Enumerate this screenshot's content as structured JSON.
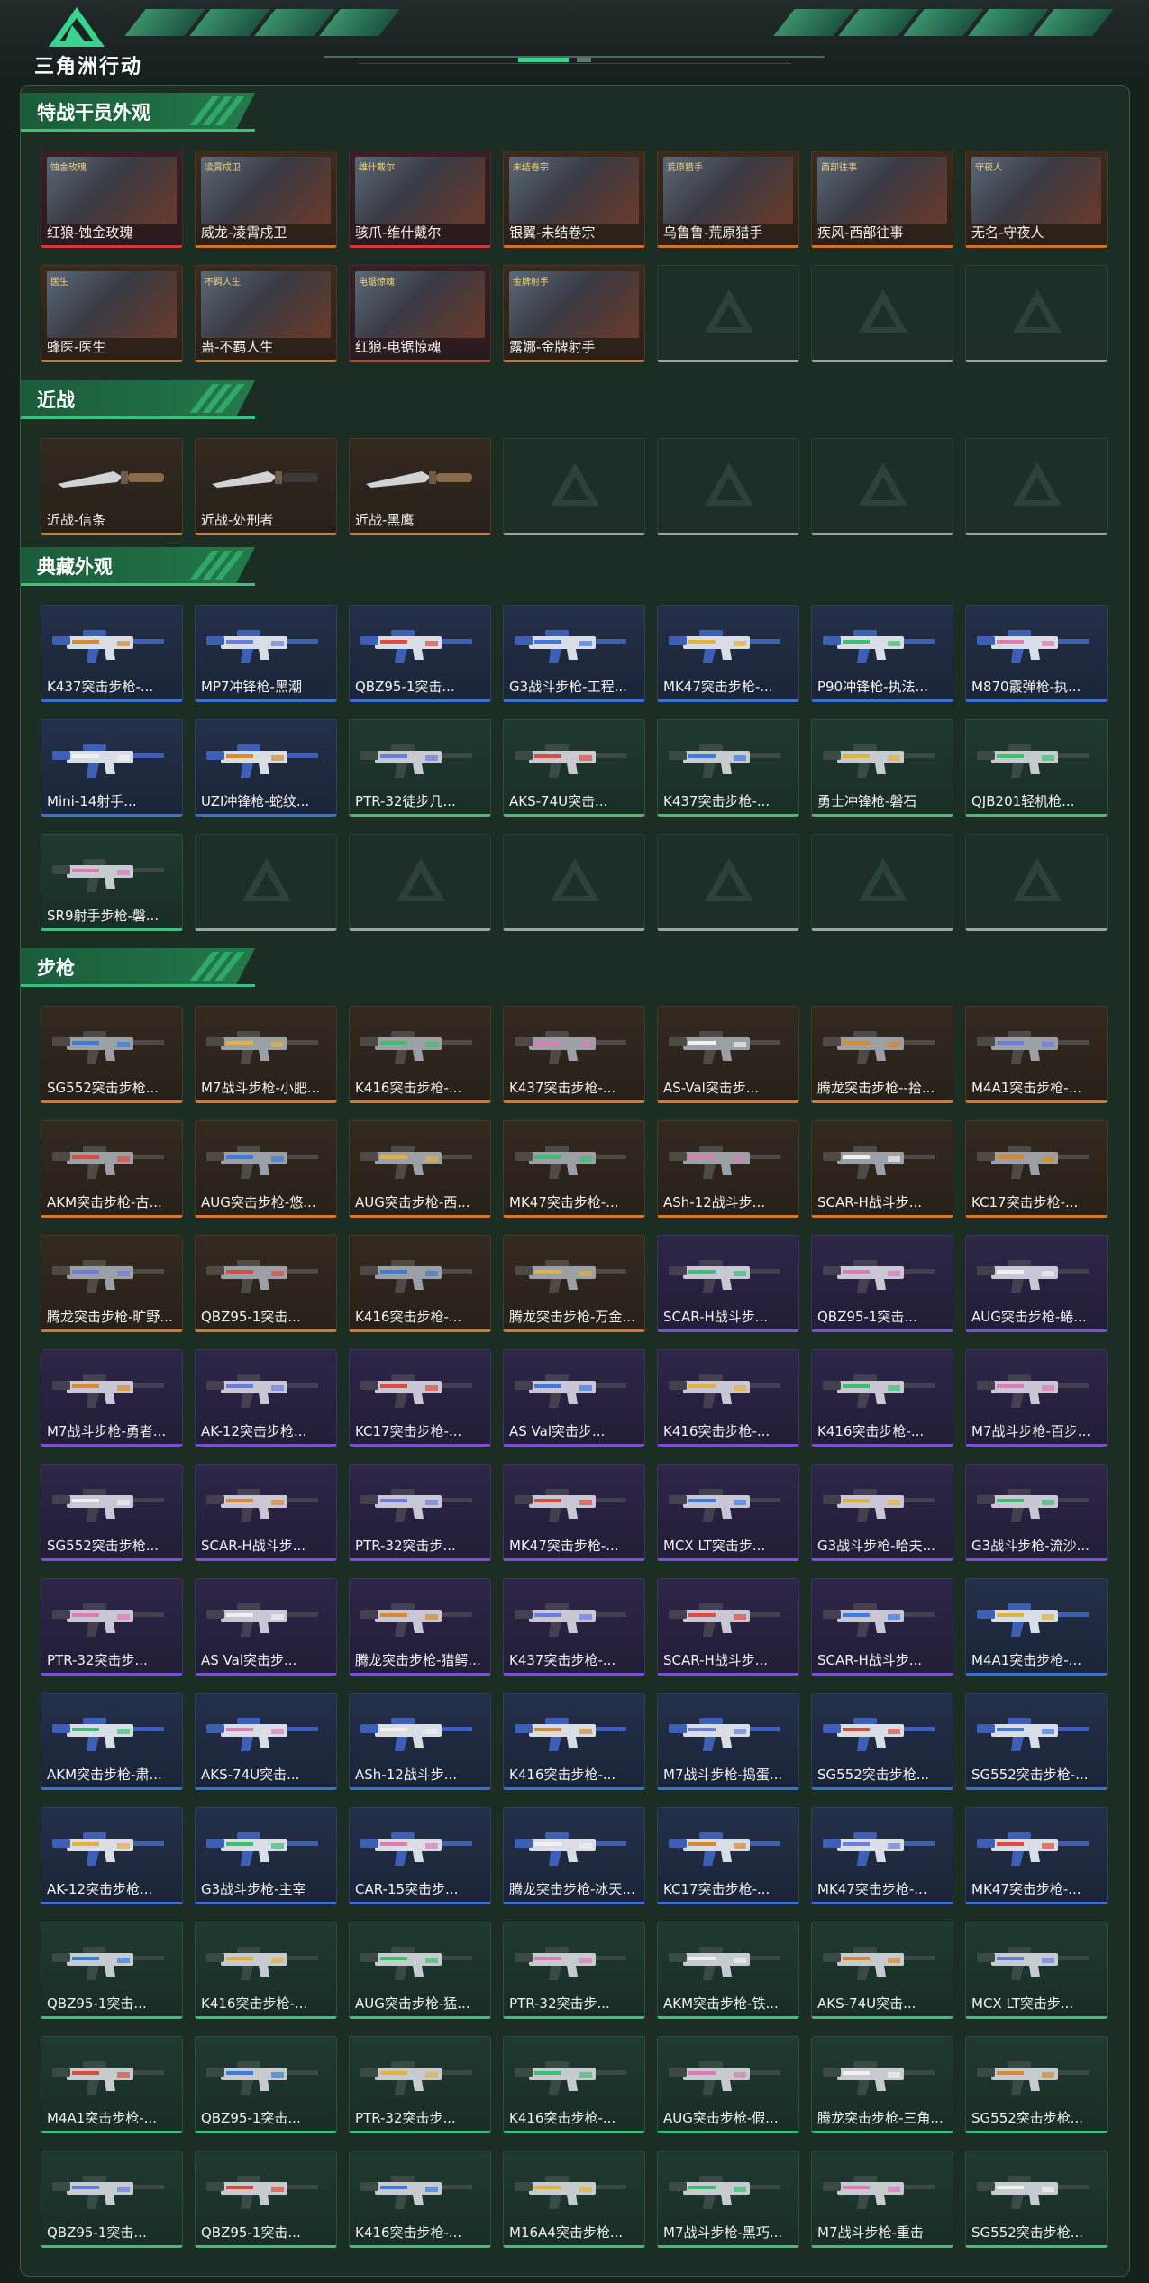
{
  "header": {
    "logo_text": "三角洲行动"
  },
  "sections": [
    {
      "key": "operators",
      "title": "特战干员外观",
      "rarity": "gold",
      "items": [
        {
          "label": "红狼-蚀金玫瑰",
          "tag": "蚀金玫瑰",
          "rarity": "red"
        },
        {
          "label": "威龙-凌霄戍卫",
          "tag": "凌霄戍卫",
          "rarity": "gold"
        },
        {
          "label": "骇爪-维什戴尔",
          "tag": "维什戴尔",
          "rarity": "red"
        },
        {
          "label": "银翼-未结卷宗",
          "tag": "未结卷宗",
          "rarity": "gold"
        },
        {
          "label": "乌鲁鲁-荒原猎手",
          "tag": "荒原猎手",
          "rarity": "gold"
        },
        {
          "label": "疾风-西部往事",
          "tag": "西部往事",
          "rarity": "gold"
        },
        {
          "label": "无名-守夜人",
          "tag": "守夜人",
          "rarity": "gold"
        },
        {
          "label": "蜂医-医生",
          "tag": "医生",
          "rarity": "gold"
        },
        {
          "label": "蛊-不羁人生",
          "tag": "不羁人生",
          "rarity": "gold"
        },
        {
          "label": "红狼-电锯惊魂",
          "tag": "电锯惊魂",
          "rarity": "red"
        },
        {
          "label": "露娜-金牌射手",
          "tag": "金牌射手",
          "rarity": "gold"
        },
        {
          "label": "",
          "rarity": "empty"
        },
        {
          "label": "",
          "rarity": "empty"
        },
        {
          "label": "",
          "rarity": "empty"
        }
      ]
    },
    {
      "key": "melee",
      "title": "近战",
      "items": [
        {
          "label": "近战-信条",
          "rarity": "orange",
          "art": "knife"
        },
        {
          "label": "近战-处刑者",
          "rarity": "orange",
          "art": "knife"
        },
        {
          "label": "近战-黑鹰",
          "rarity": "orange",
          "art": "knife"
        },
        {
          "label": "",
          "rarity": "empty"
        },
        {
          "label": "",
          "rarity": "empty"
        },
        {
          "label": "",
          "rarity": "empty"
        },
        {
          "label": "",
          "rarity": "empty"
        }
      ]
    },
    {
      "key": "collection",
      "title": "典藏外观",
      "items": [
        {
          "label": "K437突击步枪-...",
          "rarity": "blue"
        },
        {
          "label": "MP7冲锋枪-黑潮",
          "rarity": "blue"
        },
        {
          "label": "QBZ95-1突击...",
          "rarity": "blue"
        },
        {
          "label": "G3战斗步枪-工程...",
          "rarity": "blue"
        },
        {
          "label": "MK47突击步枪-...",
          "rarity": "blue"
        },
        {
          "label": "P90冲锋枪-执法...",
          "rarity": "blue"
        },
        {
          "label": "M870霰弹枪-执...",
          "rarity": "blue"
        },
        {
          "label": "Mini-14射手...",
          "rarity": "blue"
        },
        {
          "label": "UZI冲锋枪-蛇纹...",
          "rarity": "blue"
        },
        {
          "label": "PTR-32徒步几...",
          "rarity": "green"
        },
        {
          "label": "AKS-74U突击...",
          "rarity": "green"
        },
        {
          "label": "K437突击步枪-...",
          "rarity": "green"
        },
        {
          "label": "勇士冲锋枪-磐石",
          "rarity": "green"
        },
        {
          "label": "QJB201轻机枪...",
          "rarity": "green"
        },
        {
          "label": "SR9射手步枪-磐...",
          "rarity": "green"
        },
        {
          "label": "",
          "rarity": "empty"
        },
        {
          "label": "",
          "rarity": "empty"
        },
        {
          "label": "",
          "rarity": "empty"
        },
        {
          "label": "",
          "rarity": "empty"
        },
        {
          "label": "",
          "rarity": "empty"
        },
        {
          "label": "",
          "rarity": "empty"
        }
      ]
    },
    {
      "key": "rifles",
      "title": "步枪",
      "items": [
        {
          "label": "SG552突击步枪...",
          "rarity": "orange"
        },
        {
          "label": "M7战斗步枪-小肥...",
          "rarity": "orange"
        },
        {
          "label": "K416突击步枪-...",
          "rarity": "orange"
        },
        {
          "label": "K437突击步枪-...",
          "rarity": "orange"
        },
        {
          "label": "AS-Val突击步...",
          "rarity": "orange"
        },
        {
          "label": "腾龙突击步枪--拾...",
          "rarity": "orange"
        },
        {
          "label": "M4A1突击步枪-...",
          "rarity": "orange"
        },
        {
          "label": "AKM突击步枪-古...",
          "rarity": "orange"
        },
        {
          "label": "AUG突击步枪-悠...",
          "rarity": "orange"
        },
        {
          "label": "AUG突击步枪-西...",
          "rarity": "orange"
        },
        {
          "label": "MK47突击步枪-...",
          "rarity": "orange"
        },
        {
          "label": "ASh-12战斗步...",
          "rarity": "orange"
        },
        {
          "label": "SCAR-H战斗步...",
          "rarity": "orange"
        },
        {
          "label": "KC17突击步枪-...",
          "rarity": "orange"
        },
        {
          "label": "腾龙突击步枪-旷野...",
          "rarity": "orange"
        },
        {
          "label": "QBZ95-1突击...",
          "rarity": "orange"
        },
        {
          "label": "K416突击步枪-...",
          "rarity": "orange"
        },
        {
          "label": "腾龙突击步枪-万金...",
          "rarity": "orange"
        },
        {
          "label": "SCAR-H战斗步...",
          "rarity": "purple"
        },
        {
          "label": "QBZ95-1突击...",
          "rarity": "purple"
        },
        {
          "label": "AUG突击步枪-蜷...",
          "rarity": "purple"
        },
        {
          "label": "M7战斗步枪-勇者...",
          "rarity": "purple"
        },
        {
          "label": "AK-12突击步枪...",
          "rarity": "purple"
        },
        {
          "label": "KC17突击步枪-...",
          "rarity": "purple"
        },
        {
          "label": "AS Val突击步...",
          "rarity": "purple"
        },
        {
          "label": "K416突击步枪-...",
          "rarity": "purple"
        },
        {
          "label": "K416突击步枪-...",
          "rarity": "purple"
        },
        {
          "label": "M7战斗步枪-百步...",
          "rarity": "purple"
        },
        {
          "label": "SG552突击步枪...",
          "rarity": "purple"
        },
        {
          "label": "SCAR-H战斗步...",
          "rarity": "purple"
        },
        {
          "label": "PTR-32突击步...",
          "rarity": "purple"
        },
        {
          "label": "MK47突击步枪-...",
          "rarity": "purple"
        },
        {
          "label": "MCX LT突击步...",
          "rarity": "purple"
        },
        {
          "label": "G3战斗步枪-哈夫...",
          "rarity": "purple"
        },
        {
          "label": "G3战斗步枪-流沙...",
          "rarity": "purple"
        },
        {
          "label": "PTR-32突击步...",
          "rarity": "purple"
        },
        {
          "label": "AS Val突击步...",
          "rarity": "purple"
        },
        {
          "label": "腾龙突击步枪-猎鳄...",
          "rarity": "purple"
        },
        {
          "label": "K437突击步枪-...",
          "rarity": "purple"
        },
        {
          "label": "SCAR-H战斗步...",
          "rarity": "purple"
        },
        {
          "label": "SCAR-H战斗步...",
          "rarity": "purple"
        },
        {
          "label": "M4A1突击步枪-...",
          "rarity": "blue"
        },
        {
          "label": "AKM突击步枪-肃...",
          "rarity": "blue"
        },
        {
          "label": "AKS-74U突击...",
          "rarity": "blue"
        },
        {
          "label": "ASh-12战斗步...",
          "rarity": "blue"
        },
        {
          "label": "K416突击步枪-...",
          "rarity": "blue"
        },
        {
          "label": "M7战斗步枪-捣蛋...",
          "rarity": "blue"
        },
        {
          "label": "SG552突击步枪...",
          "rarity": "blue"
        },
        {
          "label": "SG552突击步枪-...",
          "rarity": "blue"
        },
        {
          "label": "AK-12突击步枪...",
          "rarity": "blue"
        },
        {
          "label": "G3战斗步枪-主宰",
          "rarity": "blue"
        },
        {
          "label": "CAR-15突击步...",
          "rarity": "blue"
        },
        {
          "label": "腾龙突击步枪-冰天...",
          "rarity": "blue"
        },
        {
          "label": "KC17突击步枪-...",
          "rarity": "blue"
        },
        {
          "label": "MK47突击步枪-...",
          "rarity": "blue"
        },
        {
          "label": "MK47突击步枪-...",
          "rarity": "blue"
        },
        {
          "label": "QBZ95-1突击...",
          "rarity": "green"
        },
        {
          "label": "K416突击步枪-...",
          "rarity": "green"
        },
        {
          "label": "AUG突击步枪-猛...",
          "rarity": "green"
        },
        {
          "label": "PTR-32突击步...",
          "rarity": "green"
        },
        {
          "label": "AKM突击步枪-铁...",
          "rarity": "green"
        },
        {
          "label": "AKS-74U突击...",
          "rarity": "green"
        },
        {
          "label": "MCX LT突击步...",
          "rarity": "green"
        },
        {
          "label": "M4A1突击步枪-...",
          "rarity": "green"
        },
        {
          "label": "QBZ95-1突击...",
          "rarity": "green"
        },
        {
          "label": "PTR-32突击步...",
          "rarity": "green"
        },
        {
          "label": "K416突击步枪-...",
          "rarity": "green"
        },
        {
          "label": "AUG突击步枪-假...",
          "rarity": "green"
        },
        {
          "label": "腾龙突击步枪-三角...",
          "rarity": "green"
        },
        {
          "label": "SG552突击步枪...",
          "rarity": "green"
        },
        {
          "label": "QBZ95-1突击...",
          "rarity": "green"
        },
        {
          "label": "QBZ95-1突击...",
          "rarity": "green"
        },
        {
          "label": "K416突击步枪-...",
          "rarity": "green"
        },
        {
          "label": "M16A4突击步枪...",
          "rarity": "green"
        },
        {
          "label": "M7战斗步枪-黑巧...",
          "rarity": "green"
        },
        {
          "label": "M7战斗步枪-重击",
          "rarity": "green"
        },
        {
          "label": "SG552突击步枪...",
          "rarity": "green"
        }
      ]
    }
  ]
}
